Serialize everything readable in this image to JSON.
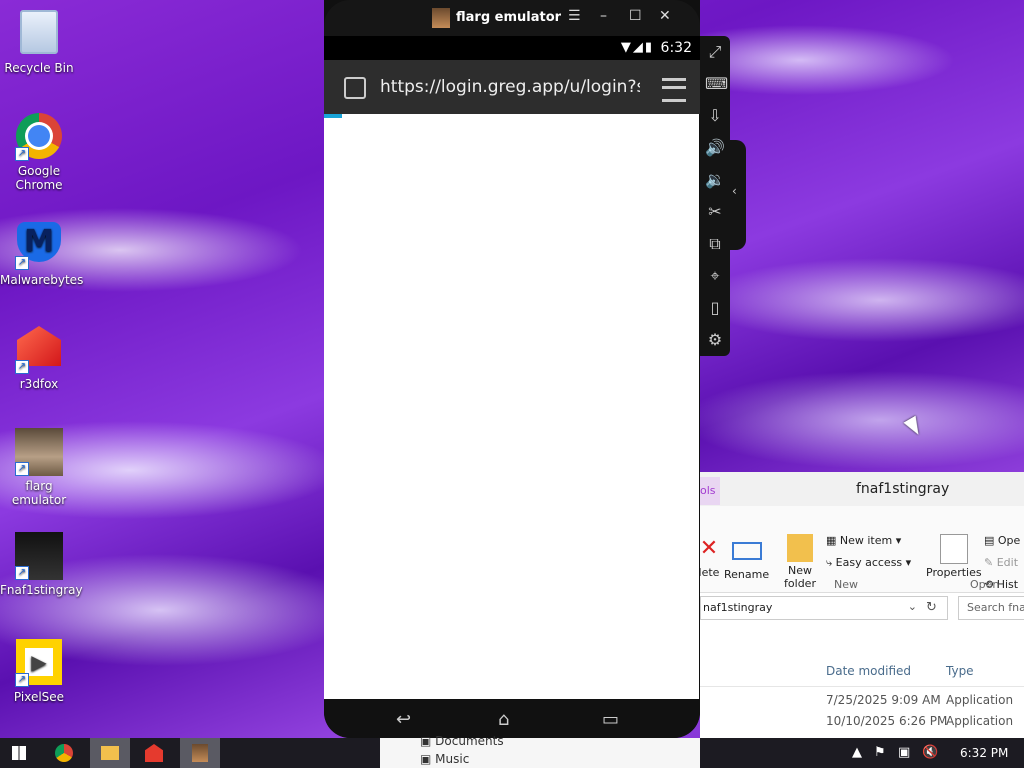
{
  "desktop": {
    "icons": [
      {
        "label": "Recycle Bin"
      },
      {
        "label": "Google Chrome"
      },
      {
        "label": "Malwarebytes"
      },
      {
        "label": "r3dfox"
      },
      {
        "label": "flarg emulator"
      },
      {
        "label": "Fnaf1stingray"
      },
      {
        "label": "PixelSee"
      }
    ]
  },
  "emulator": {
    "title": "flarg emulator",
    "status_time": "6:32",
    "url": "https://login.greg.app/u/login?state",
    "controls": {
      "menu": "☰",
      "minimize": "–",
      "maximize": "☐",
      "close": "✕"
    }
  },
  "explorer": {
    "title": "fnaf1stingray",
    "tools_tab": "ols",
    "ribbon": {
      "delete": "lete",
      "rename": "Rename",
      "new_folder": "New folder",
      "new_item": "New item",
      "easy_access": "Easy access",
      "properties": "Properties",
      "open": "Ope",
      "edit": "Edit",
      "history": "Hist",
      "group_new": "New",
      "group_open": "Open"
    },
    "address": "naf1stingray",
    "search_placeholder": "Search fnaf",
    "columns": {
      "date": "Date modified",
      "type": "Type"
    },
    "rows": [
      {
        "date": "7/25/2025 9:09 AM",
        "type": "Application"
      },
      {
        "date": "10/10/2025 6:26 PM",
        "type": "Application"
      }
    ]
  },
  "folders": [
    "Documents",
    "Music"
  ],
  "taskbar": {
    "clock": "6:32 PM"
  }
}
